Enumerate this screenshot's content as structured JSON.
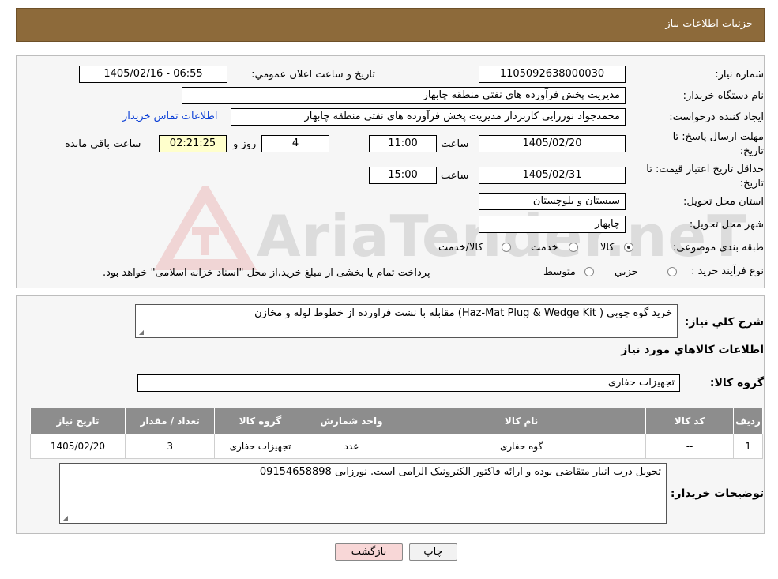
{
  "header": {
    "title": "جزئیات اطلاعات نیاز"
  },
  "fields": {
    "need_number_label": "شماره نیاز:",
    "need_number": "1105092638000030",
    "announce_label": "تاريخ و ساعت اعلان عمومي:",
    "announce_value": "1405/02/16 - 06:55",
    "buyer_org_label": "نام دستگاه خريدار:",
    "buyer_org": "مدیریت پخش فرآورده های نفتی منطقه چابهار",
    "creator_label": "ايجاد کننده درخواست:",
    "creator": "محمدجواد نورزایی کاربرداز مدیریت پخش فرآورده های نفتی منطقه چابهار",
    "contact_link": "اطلاعات تماس خريدار",
    "deadline_label_1": "مهلت ارسال پاسخ: تا",
    "deadline_label_2": "تاريخ:",
    "deadline_date": "1405/02/20",
    "time_label": "ساعت",
    "deadline_time": "11:00",
    "days_value": "4",
    "days_label": "روز و",
    "remaining_time": "02:21:25",
    "remaining_label": "ساعت باقي مانده",
    "validity_label_1": "حداقل تاريخ اعتبار قيمت: تا",
    "validity_label_2": "تاريخ:",
    "validity_date": "1405/02/31",
    "validity_time_label": "ساعت",
    "validity_time": "15:00",
    "province_label": "استان محل تحويل:",
    "province": "سیستان و بلوچستان",
    "city_label": "شهر محل تحويل:",
    "city": "چابهار",
    "category_label": "طبقه بندی موضوعی:",
    "category_options": [
      "کالا",
      "خدمت",
      "کالا/خدمت"
    ],
    "process_label": "نوع فرآيند خريد :",
    "process_options": [
      "جزیي",
      "متوسط"
    ],
    "process_note": "پرداخت تمام یا بخشی از مبلغ خرید،از محل \"اسناد خزانه اسلامی\" خواهد بود."
  },
  "summary": {
    "label": "شرح کلي نياز:",
    "text": "خرید گوه چوبی ( Haz-Mat Plug & Wedge Kit)  مقابله با نشت فراورده از خطوط  لوله و مخازن",
    "goods_info_title": "اطلاعات کالاهاي مورد نياز",
    "goods_group_label": "گروه کالا:",
    "goods_group": "تجهیزات حفاری"
  },
  "table": {
    "headers": [
      "رديف",
      "کد کالا",
      "نام کالا",
      "واحد شمارش",
      "گروه کالا",
      "تعداد / مقدار",
      "تاريخ نياز"
    ],
    "rows": [
      [
        "1",
        "--",
        "گوه حفاری",
        "عدد",
        "تجهیزات حفاری",
        "3",
        "1405/02/20"
      ]
    ]
  },
  "buyer_notes": {
    "label": "توضيحات خريدار:",
    "text": "تحویل درب انبار متقاضی بوده و ارائه فاکتور الکترونیک الزامی است. نورزایی 09154658898"
  },
  "buttons": {
    "print": "چاپ",
    "back": "بازگشت"
  },
  "colors": {
    "header": "#8d6a3a",
    "table_header": "#8d8d8d",
    "back_button": "#f8d7d7"
  },
  "watermark": {
    "text": "AriaTender.neT"
  }
}
